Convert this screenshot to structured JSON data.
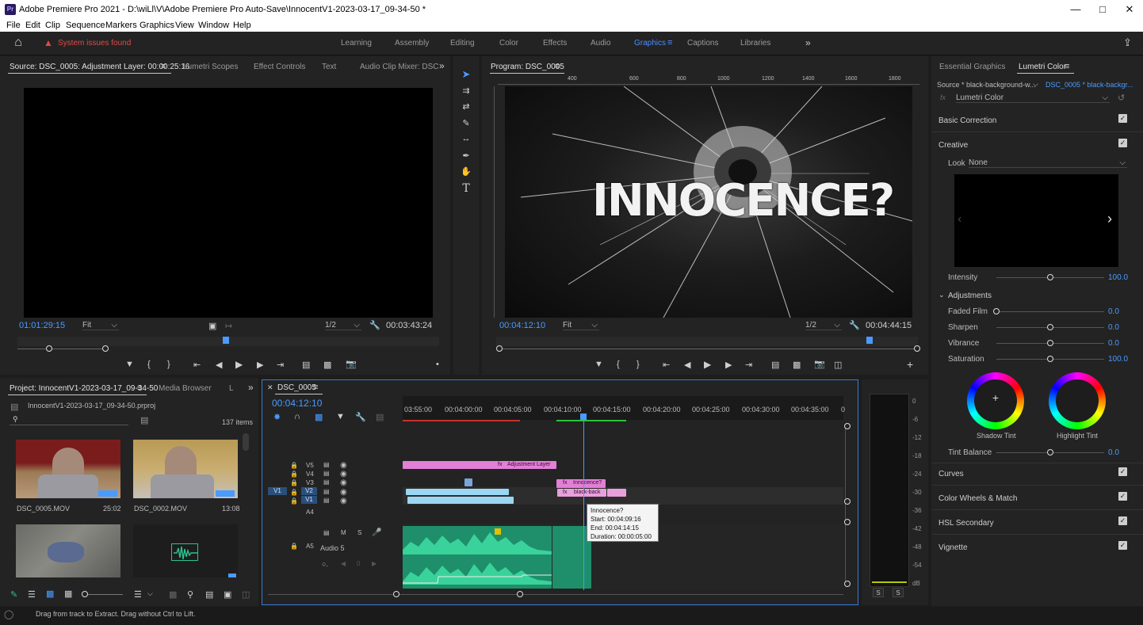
{
  "app": {
    "title": "Adobe Premiere Pro 2021 - D:\\wiLl\\V\\Adobe Premiere Pro Auto-Save\\InnocentV1-2023-03-17_09-34-50 *",
    "logo": "Pr"
  },
  "menu": [
    "File",
    "Edit",
    "Clip",
    "Sequence",
    "Markers",
    "Graphics",
    "View",
    "Window",
    "Help"
  ],
  "workspace_bar": {
    "alert": "System issues found",
    "workspaces": [
      "Learning",
      "Assembly",
      "Editing",
      "Color",
      "Effects",
      "Audio",
      "Graphics",
      "Captions",
      "Libraries"
    ],
    "active": "Graphics",
    "more": "»"
  },
  "source_panel": {
    "tabs": [
      "Source: DSC_0005: Adjustment Layer: 00:00:25:16",
      "Lumetri Scopes",
      "Effect Controls",
      "Text",
      "Audio Clip Mixer: DSC"
    ],
    "timecode": "01:01:29:15",
    "fit": "Fit",
    "resolution": "1/2",
    "duration": "00:03:43:24"
  },
  "program_panel": {
    "title": "Program: DSC_0005",
    "ruler_labels": [
      "400",
      "600",
      "800",
      "1000",
      "1200",
      "1400",
      "1600",
      "1800"
    ],
    "video_text": "INNOCENCE?",
    "timecode": "00:04:12:10",
    "fit": "Fit",
    "resolution": "1/2",
    "duration": "00:04:44:15"
  },
  "lumetri": {
    "tabs": [
      "Essential Graphics",
      "Lumetri Color"
    ],
    "source_label": "Source * black-background-w...",
    "target_label": "DSC_0005 * black-backgr...",
    "fx_label": "fx",
    "effect": "Lumetri Color",
    "basic_correction": "Basic Correction",
    "creative": "Creative",
    "look_label": "Look",
    "look_value": "None",
    "intensity_label": "Intensity",
    "intensity_value": "100.0",
    "adjustments": "Adjustments",
    "faded_film_label": "Faded Film",
    "faded_film_value": "0.0",
    "sharpen_label": "Sharpen",
    "sharpen_value": "0.0",
    "vibrance_label": "Vibrance",
    "vibrance_value": "0.0",
    "saturation_label": "Saturation",
    "saturation_value": "100.0",
    "shadow_tint": "Shadow Tint",
    "highlight_tint": "Highlight Tint",
    "tint_balance_label": "Tint Balance",
    "tint_balance_value": "0.0",
    "curves": "Curves",
    "color_wheels": "Color Wheels & Match",
    "hsl_secondary": "HSL Secondary",
    "vignette": "Vignette",
    "slider_levels": {
      "intensity": 0.5,
      "faded_film": 0.0,
      "sharpen": 0.5,
      "vibrance": 0.5,
      "saturation": 0.5,
      "tint_balance": 0.5
    }
  },
  "project_panel": {
    "tabs": [
      "Project: InnocentV1-2023-03-17_09-34-50",
      "Media Browser",
      "L"
    ],
    "project_file": "InnocentV1-2023-03-17_09-34-50.prproj",
    "item_count": "137 items",
    "items": [
      {
        "name": "DSC_0005.MOV",
        "duration": "25:02"
      },
      {
        "name": "DSC_0002.MOV",
        "duration": "13:08"
      }
    ]
  },
  "timeline": {
    "tab": "DSC_0005",
    "timecode": "00:04:12:10",
    "ticks": [
      "03:55:00",
      "00:04:00:00",
      "00:04:05:00",
      "00:04:10:00",
      "00:04:15:00",
      "00:04:20:00",
      "00:04:25:00",
      "00:04:30:00",
      "00:04:35:00",
      "0"
    ],
    "tracks": [
      "V5",
      "V4",
      "V3",
      "V2",
      "V1",
      "A4",
      "A5"
    ],
    "source_patch": "V1",
    "audio_track_name": "Audio 5",
    "audio_buttons": [
      "M",
      "S"
    ],
    "audio_level": "0",
    "clips": {
      "adjustment_layer": "Adjustment Layer",
      "innocence": "Innocence?",
      "black_back": "black-back"
    },
    "tooltip": {
      "name": "Innocence?",
      "start": "Start: 00:04:09:16",
      "end": "End: 00:04:14:15",
      "duration": "Duration: 00:00:05:00"
    }
  },
  "meter": {
    "labels": [
      "0",
      "-6",
      "-12",
      "-18",
      "-24",
      "-30",
      "-36",
      "-42",
      "-48",
      "-54",
      "dB"
    ],
    "solo": [
      "S",
      "S"
    ]
  },
  "status_bar": "Drag from track to Extract. Drag without Ctrl to Lift."
}
